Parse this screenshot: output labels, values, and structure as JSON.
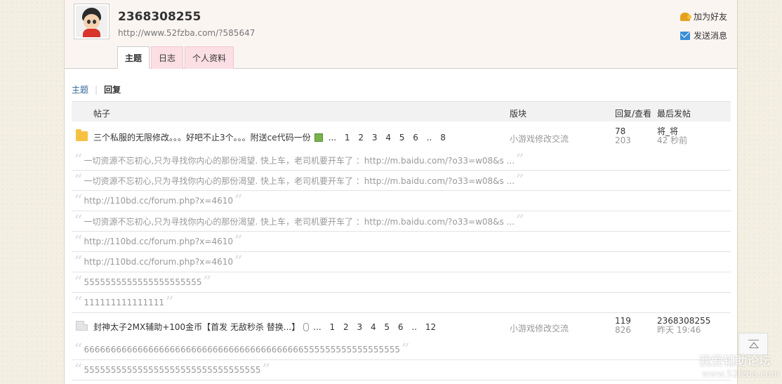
{
  "profile": {
    "username": "2368308255",
    "url": "http://www.52fzba.com/?585647",
    "actions": [
      {
        "label": "加为好友",
        "icon": "add-friend-icon"
      },
      {
        "label": "发送消息",
        "icon": "mail-icon"
      }
    ]
  },
  "tabs": [
    {
      "label": "主题",
      "active": true
    },
    {
      "label": "日志",
      "active": false
    },
    {
      "label": "个人资料",
      "active": false
    }
  ],
  "subnav": {
    "link": "主题",
    "current": "回复"
  },
  "table_header": {
    "post": "帖子",
    "forum": "版块",
    "counts": "回复/查看",
    "last": "最后发帖"
  },
  "threads": [
    {
      "title": "三个私服的无限修改。。。好吧不止3个。。。附送ce代码一份",
      "attachment_icon": "image-icon",
      "pages": [
        "...",
        "1",
        "2",
        "3",
        "4",
        "5",
        "6",
        "..",
        "8"
      ],
      "forum": "小游戏修改交流",
      "replies": "78",
      "views": "203",
      "last_user": "将_将",
      "last_time": "42 秒前"
    },
    {
      "title": "封神太子2MX辅助+100金币【首发 无敌秒杀 替换...】",
      "attachment_icon": "paperclip-icon",
      "pages": [
        "...",
        "1",
        "2",
        "3",
        "4",
        "5",
        "6",
        "..",
        "12"
      ],
      "forum": "小游戏修改交流",
      "replies": "119",
      "views": "826",
      "last_user": "2368308255",
      "last_time": "昨天 19:46"
    }
  ],
  "quotes": [
    "一切资源不忘初心,只为寻找你内心的那份渴望. 快上车，老司机要开车了 ：http://m.baidu.com/?o33=w08&s ...",
    "一切资源不忘初心,只为寻找你内心的那份渴望. 快上车，老司机要开车了 ：http://m.baidu.com/?o33=w08&s ...",
    "http://110bd.cc/forum.php?x=4610",
    "一切资源不忘初心,只为寻找你内心的那份渴望. 快上车，老司机要开车了 ：http://m.baidu.com/?o33=w08&s ...",
    "http://110bd.cc/forum.php?x=4610",
    "http://110bd.cc/forum.php?x=4610",
    "5555555555555555555555",
    "111111111111111",
    "66666666666666666666666666666666666666666555555555555555555",
    "555555555555555555555555555555555"
  ],
  "watermark": {
    "line1": "我爱辅助论坛",
    "line2": "www.52fzba.com"
  }
}
